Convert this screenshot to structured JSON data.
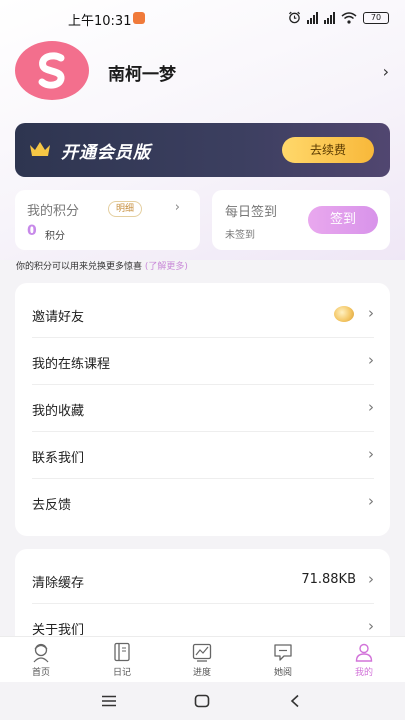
{
  "status_bar": {
    "time": "上午10:31",
    "battery": "70",
    "icons": [
      "alarm-icon",
      "hd-signal-icon",
      "hd-signal-icon",
      "wifi-icon",
      "battery-icon"
    ]
  },
  "profile": {
    "username": "南柯一梦",
    "avatar_icon": "app-logo-s-icon",
    "avatar_color": "#f36f8d"
  },
  "vip": {
    "title": "开通会员版",
    "button": "去续费",
    "icon": "crown-icon"
  },
  "points": {
    "title": "我的积分",
    "detail_tag": "明细",
    "value": "0",
    "unit": "积分"
  },
  "sign_in": {
    "title": "每日签到",
    "status": "未签到",
    "button": "签到"
  },
  "points_note": {
    "text": "你的积分可以用来兑换更多惊喜",
    "link": "(了解更多)"
  },
  "menu": [
    {
      "label": "邀请好友"
    },
    {
      "label": "我的在练课程"
    },
    {
      "label": "我的收藏"
    },
    {
      "label": "联系我们"
    },
    {
      "label": "去反馈"
    }
  ],
  "menu2": [
    {
      "label": "清除缓存",
      "value": "71.88KB"
    },
    {
      "label": "关于我们"
    }
  ],
  "tabs": [
    {
      "label": "首页",
      "icon": "home-avatar-icon"
    },
    {
      "label": "日记",
      "icon": "diary-icon"
    },
    {
      "label": "进度",
      "icon": "progress-icon"
    },
    {
      "label": "她阅",
      "icon": "read-icon"
    },
    {
      "label": "我的",
      "icon": "profile-icon",
      "active": true
    }
  ],
  "colors": {
    "accent": "#d273d9",
    "vip_bg": "#2e3550",
    "vip_button": "#f8c24a"
  }
}
